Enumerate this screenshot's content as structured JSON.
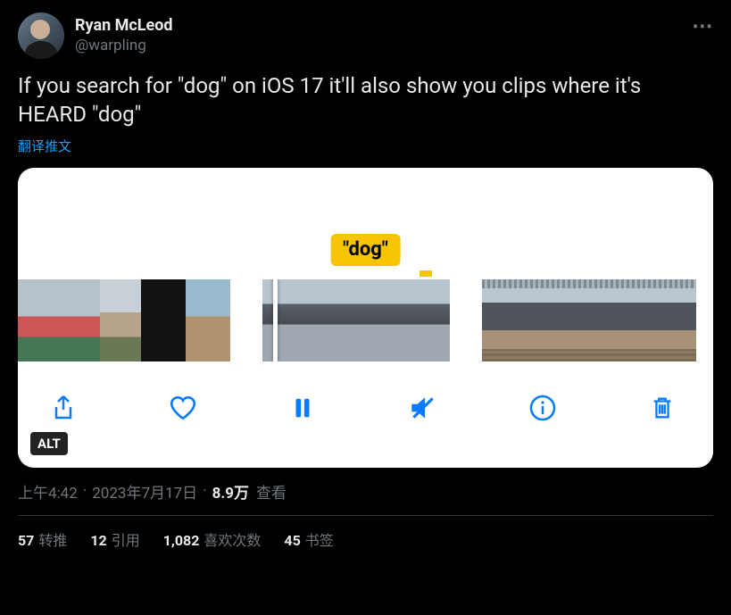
{
  "user": {
    "display_name": "Ryan McLeod",
    "handle": "@warpling"
  },
  "tweet": {
    "text": "If you search for \"dog\" on iOS 17 it'll also show you clips where it's HEARD \"dog\"",
    "translate_label": "翻译推文"
  },
  "media": {
    "pill_label": "\"dog\"",
    "alt_badge": "ALT"
  },
  "meta": {
    "time": "上午4:42",
    "date": "2023年7月17日",
    "views_count": "8.9万",
    "views_label": "查看"
  },
  "stats": {
    "retweets_count": "57",
    "retweets_label": "转推",
    "quotes_count": "12",
    "quotes_label": "引用",
    "likes_count": "1,082",
    "likes_label": "喜欢次数",
    "bookmarks_count": "45",
    "bookmarks_label": "书签"
  }
}
